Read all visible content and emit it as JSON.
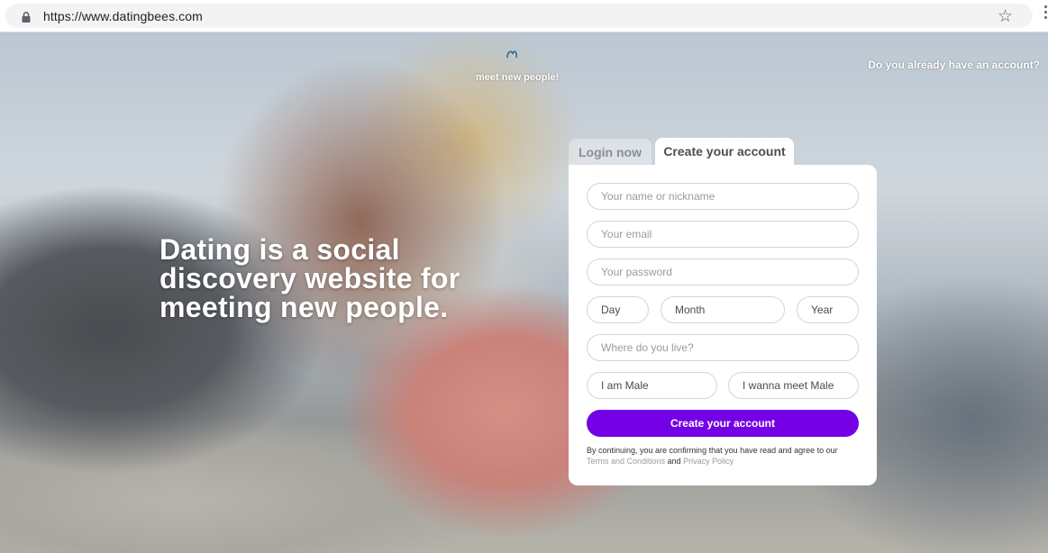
{
  "browser": {
    "url": "https://www.datingbees.com",
    "star_icon": "star-icon",
    "lock_icon": "lock-icon"
  },
  "hero": {
    "tagline": "meet new people!",
    "already_account": "Do you already have an account?",
    "headline": "Dating is a social discovery website for meeting new people."
  },
  "tabs": {
    "login": "Login now",
    "create": "Create your account"
  },
  "form": {
    "name_placeholder": "Your name or nickname",
    "email_placeholder": "Your email",
    "password_placeholder": "Your password",
    "day": "Day",
    "month": "Month",
    "year": "Year",
    "where_placeholder": "Where do you live?",
    "gender": "I am Male",
    "meet": "I wanna meet Male",
    "submit": "Create your account",
    "legal_prefix": "By continuing, you are confirming that you have read and agree to our",
    "terms": "Terms and Conditions",
    "and": "and",
    "privacy": "Privacy Policy"
  },
  "colors": {
    "primary_button": "#7400e6",
    "link_gray": "#9a9aa2"
  }
}
